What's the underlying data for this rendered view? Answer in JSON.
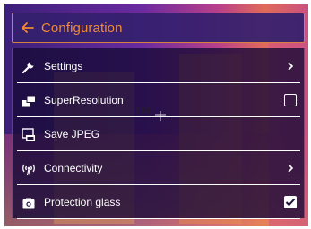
{
  "header": {
    "title": "Configuration",
    "back_icon": "arrow-left-icon",
    "accent": "#f28a2e"
  },
  "menu": {
    "items": [
      {
        "label": "Settings",
        "icon": "wrench-icon",
        "trailing": "chevron-right-icon"
      },
      {
        "label": "SuperResolution",
        "icon": "super-resolution-icon",
        "trailing": "checkbox",
        "checked": false
      },
      {
        "label": "Save JPEG",
        "icon": "jpeg-file-icon",
        "trailing": "none"
      },
      {
        "label": "Connectivity",
        "icon": "wireless-signal-icon",
        "trailing": "chevron-right-icon"
      },
      {
        "label": "Protection glass",
        "icon": "camera-icon",
        "trailing": "checkbox",
        "checked": true
      }
    ]
  },
  "crosshair": {
    "value": "150"
  }
}
